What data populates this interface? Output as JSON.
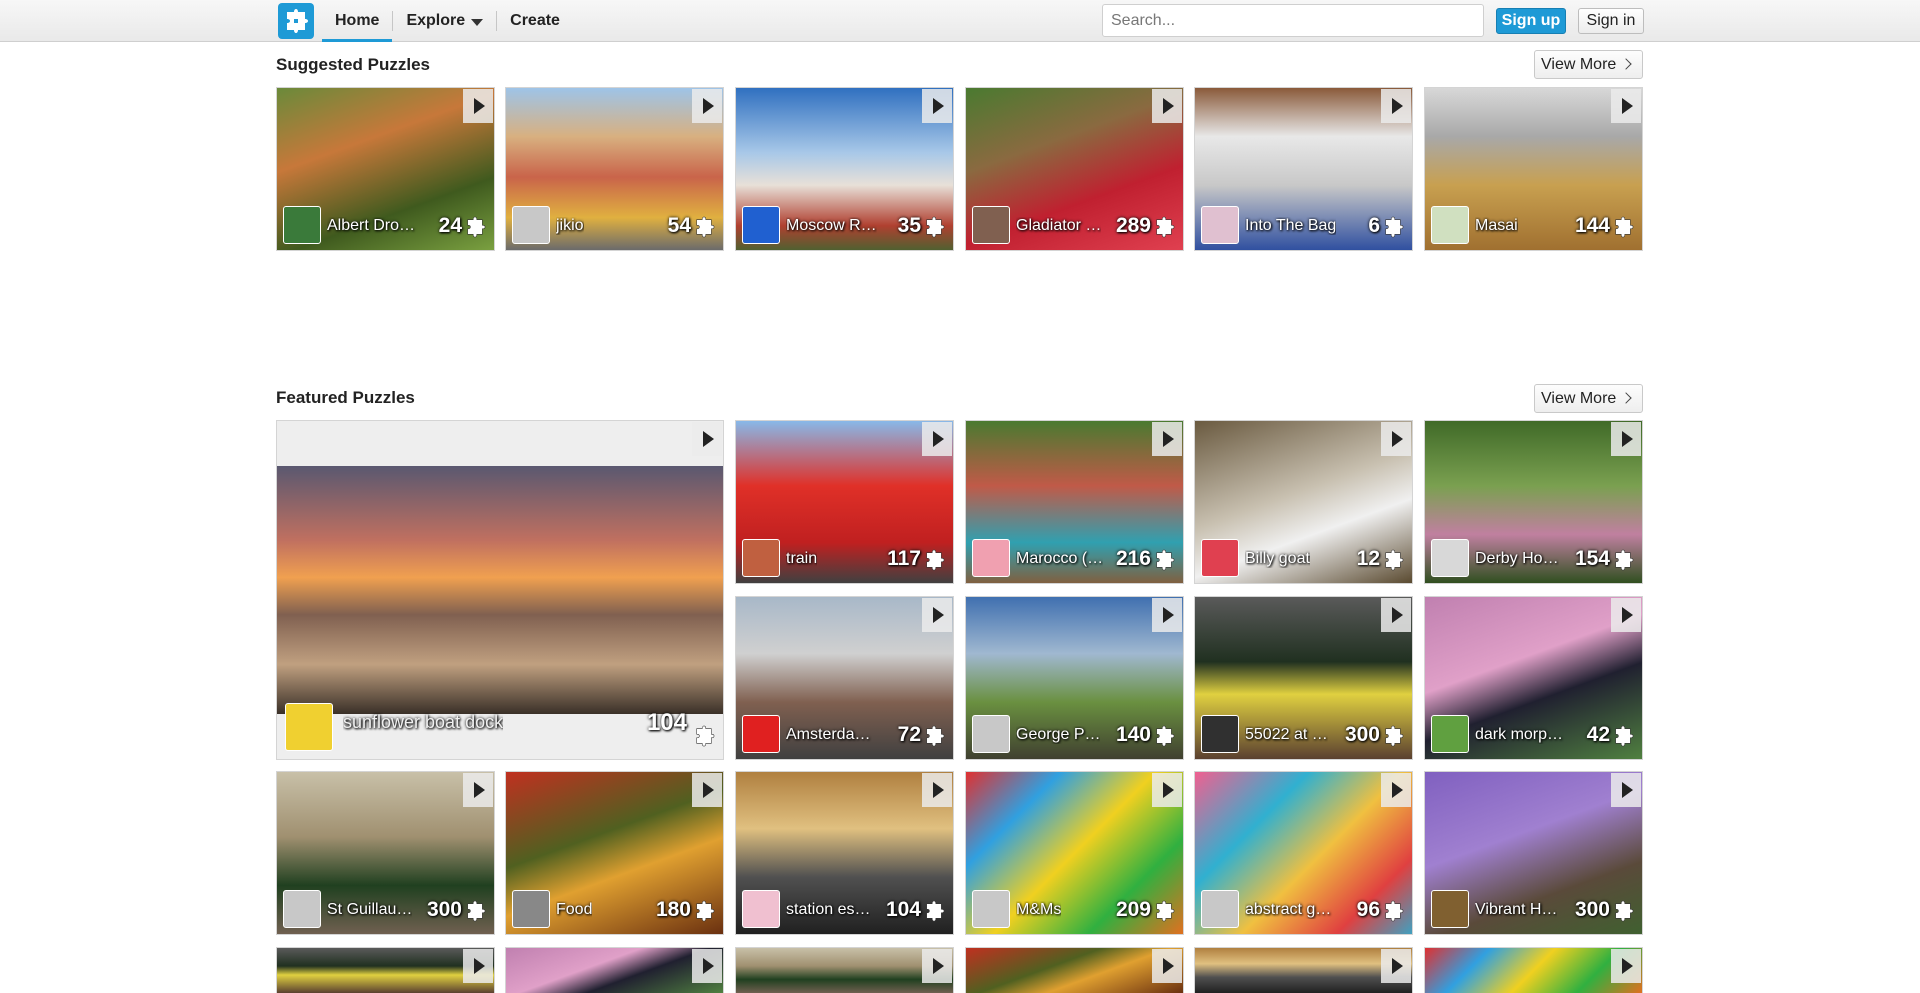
{
  "header": {
    "nav": [
      {
        "label": "Home",
        "active": true
      },
      {
        "label": "Explore",
        "dropdown": true
      },
      {
        "label": "Create"
      }
    ],
    "search_placeholder": "Search...",
    "signup_label": "Sign up",
    "signin_label": "Sign in"
  },
  "suggested": {
    "title": "Suggested Puzzles",
    "view_more": "View More",
    "tiles": [
      {
        "title": "Albert Dros…",
        "count": "24"
      },
      {
        "title": "jikio",
        "count": "54"
      },
      {
        "title": "Moscow R…",
        "count": "35"
      },
      {
        "title": "Gladiator …",
        "count": "289"
      },
      {
        "title": "Into The Bag",
        "count": "6"
      },
      {
        "title": "Masai",
        "count": "144"
      }
    ]
  },
  "featured": {
    "title": "Featured Puzzles",
    "view_more": "View More",
    "big_tile": {
      "title": "sunflower boat dock",
      "count": "104"
    },
    "tiles": [
      {
        "title": "train",
        "count": "117"
      },
      {
        "title": "Marocco (…",
        "count": "216"
      },
      {
        "title": "Billy goat",
        "count": "12"
      },
      {
        "title": "Derby Ho…",
        "count": "154"
      },
      {
        "title": "Amsterdam…",
        "count": "72"
      },
      {
        "title": "George P…",
        "count": "140"
      },
      {
        "title": "55022 at …",
        "count": "300"
      },
      {
        "title": "dark morph…",
        "count": "42"
      },
      {
        "title": "St Guillau…",
        "count": "300"
      },
      {
        "title": "Food",
        "count": "180"
      },
      {
        "title": "station es…",
        "count": "104"
      },
      {
        "title": "M&Ms",
        "count": "209"
      },
      {
        "title": "abstract ge…",
        "count": "96"
      },
      {
        "title": "Vibrant H…",
        "count": "300"
      }
    ]
  },
  "colors": {
    "brand": "#1e9ad6"
  }
}
